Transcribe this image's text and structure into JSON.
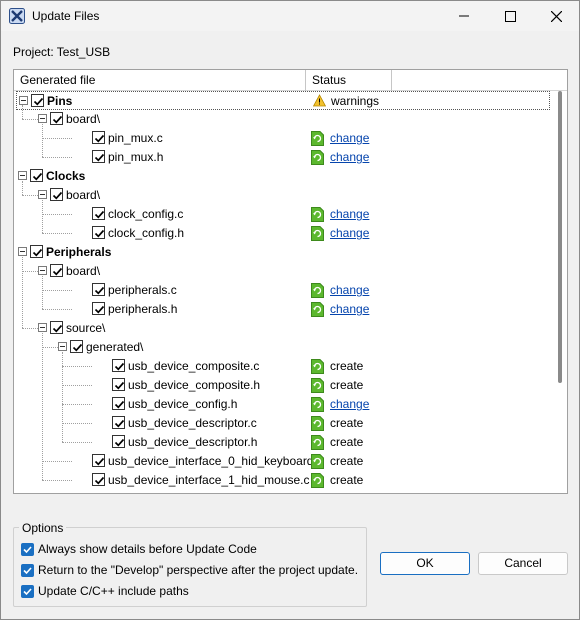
{
  "window": {
    "title": "Update Files"
  },
  "project": {
    "label": "Project: Test_USB"
  },
  "tree": {
    "columns": {
      "file": "Generated file",
      "status": "Status"
    },
    "rows": [
      {
        "depth": 0,
        "expander": true,
        "label": "Pins",
        "bold": true,
        "status": "warnings",
        "status_type": "warning",
        "focused": true
      },
      {
        "depth": 1,
        "expander": true,
        "label": "board\\",
        "bold": false,
        "status": "",
        "status_type": ""
      },
      {
        "depth": 2,
        "expander": false,
        "label": "pin_mux.c",
        "bold": false,
        "status": "change",
        "status_type": "change"
      },
      {
        "depth": 2,
        "expander": false,
        "label": "pin_mux.h",
        "bold": false,
        "status": "change",
        "status_type": "change"
      },
      {
        "depth": 0,
        "expander": true,
        "label": "Clocks",
        "bold": true,
        "status": "",
        "status_type": ""
      },
      {
        "depth": 1,
        "expander": true,
        "label": "board\\",
        "bold": false,
        "status": "",
        "status_type": ""
      },
      {
        "depth": 2,
        "expander": false,
        "label": "clock_config.c",
        "bold": false,
        "status": "change",
        "status_type": "change"
      },
      {
        "depth": 2,
        "expander": false,
        "label": "clock_config.h",
        "bold": false,
        "status": "change",
        "status_type": "change"
      },
      {
        "depth": 0,
        "expander": true,
        "label": "Peripherals",
        "bold": true,
        "status": "",
        "status_type": ""
      },
      {
        "depth": 1,
        "expander": true,
        "label": "board\\",
        "bold": false,
        "status": "",
        "status_type": ""
      },
      {
        "depth": 2,
        "expander": false,
        "label": "peripherals.c",
        "bold": false,
        "status": "change",
        "status_type": "change"
      },
      {
        "depth": 2,
        "expander": false,
        "label": "peripherals.h",
        "bold": false,
        "status": "change",
        "status_type": "change"
      },
      {
        "depth": 1,
        "expander": true,
        "label": "source\\",
        "bold": false,
        "status": "",
        "status_type": ""
      },
      {
        "depth": 2,
        "expander": true,
        "label": "generated\\",
        "bold": false,
        "status": "",
        "status_type": ""
      },
      {
        "depth": 3,
        "expander": false,
        "label": "usb_device_composite.c",
        "bold": false,
        "status": "create",
        "status_type": "create"
      },
      {
        "depth": 3,
        "expander": false,
        "label": "usb_device_composite.h",
        "bold": false,
        "status": "create",
        "status_type": "create"
      },
      {
        "depth": 3,
        "expander": false,
        "label": "usb_device_config.h",
        "bold": false,
        "status": "change",
        "status_type": "change"
      },
      {
        "depth": 3,
        "expander": false,
        "label": "usb_device_descriptor.c",
        "bold": false,
        "status": "create",
        "status_type": "create"
      },
      {
        "depth": 3,
        "expander": false,
        "label": "usb_device_descriptor.h",
        "bold": false,
        "status": "create",
        "status_type": "create"
      },
      {
        "depth": 2,
        "expander": false,
        "label": "usb_device_interface_0_hid_keyboard.c",
        "bold": false,
        "status": "create",
        "status_type": "create"
      },
      {
        "depth": 2,
        "expander": false,
        "label": "usb_device_interface_1_hid_mouse.c",
        "bold": false,
        "status": "create",
        "status_type": "create"
      }
    ]
  },
  "options": {
    "legend": "Options",
    "items": [
      {
        "label": "Always show details before Update Code",
        "checked": true
      },
      {
        "label": "Return to the \"Develop\" perspective after the project update.",
        "checked": true
      },
      {
        "label": "Update C/C++ include paths",
        "checked": true
      }
    ]
  },
  "buttons": {
    "ok": "OK",
    "cancel": "Cancel"
  },
  "colors": {
    "accent": "#1a6fc2",
    "link": "#0645ad",
    "file_icon": "#5cb82e",
    "warning": "#f2c12e"
  },
  "icons": {
    "app": "close-x-app-icon",
    "warning": "warning-icon",
    "file": "file-refresh-icon"
  }
}
